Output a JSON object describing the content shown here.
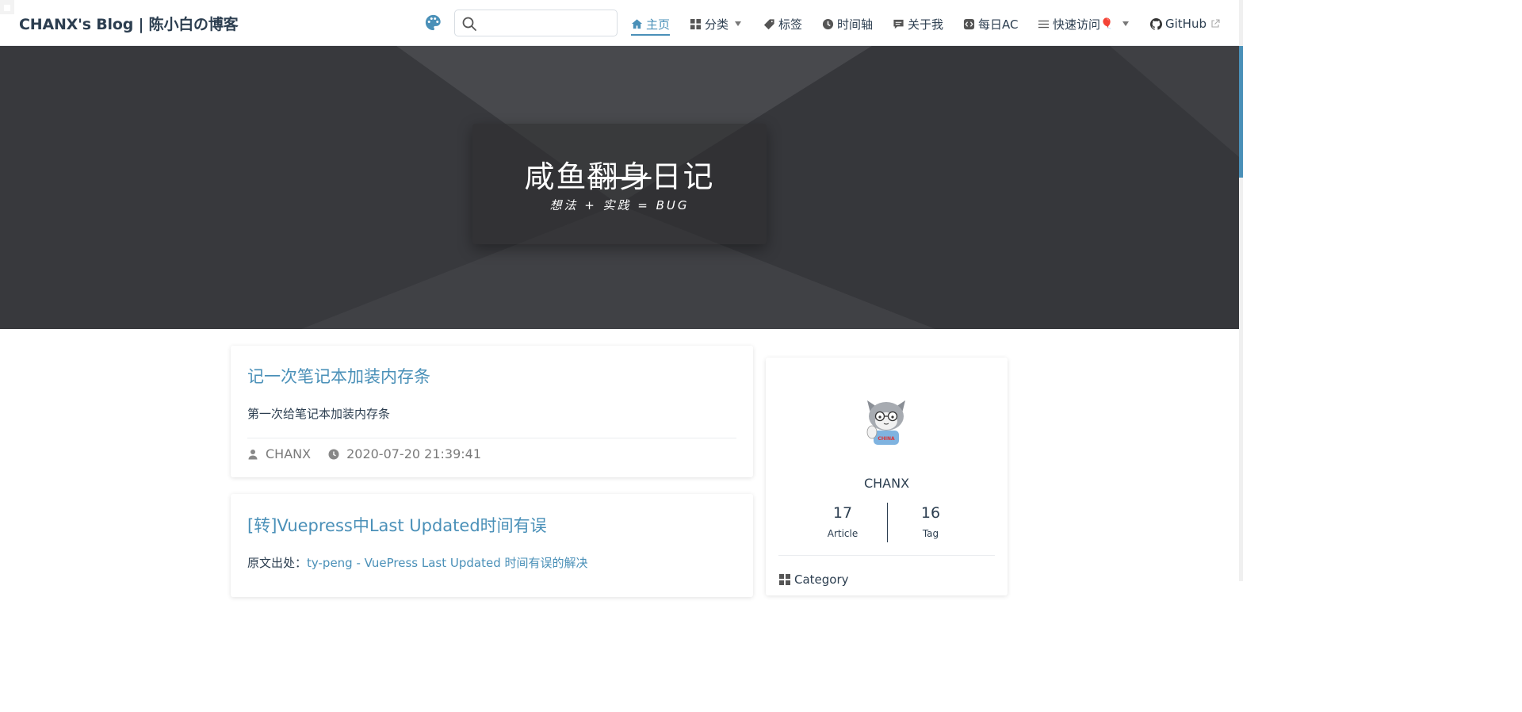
{
  "site": {
    "name": "CHANX's Blog | 陈小白の博客"
  },
  "search": {
    "placeholder": "",
    "value": ""
  },
  "nav": {
    "items": [
      {
        "label": "主页",
        "icon": "home-icon",
        "active": true
      },
      {
        "label": "分类",
        "icon": "grid-icon",
        "dropdown": true
      },
      {
        "label": "标签",
        "icon": "tag-icon"
      },
      {
        "label": "时间轴",
        "icon": "clock-icon"
      },
      {
        "label": "关于我",
        "icon": "comment-icon"
      },
      {
        "label": "每日AC",
        "icon": "code-icon"
      },
      {
        "label": "快速访问",
        "icon": "list-icon",
        "badge": "🎈",
        "dropdown": true
      },
      {
        "label": "GitHub",
        "icon": "github-icon",
        "external": true
      }
    ]
  },
  "hero": {
    "title_start": "咸鱼",
    "title_struck": "翻身",
    "title_end": "日记",
    "subtitle": "想法 + 实践 = BUG"
  },
  "posts": [
    {
      "title": "记一次笔记本加装内存条",
      "excerpt": "第一次给笔记本加装内存条",
      "author": "CHANX",
      "date": "2020-07-20 21:39:41"
    },
    {
      "title": "[转]Vuepress中Last Updated时间有误",
      "excerpt_prefix": "原文出处：",
      "excerpt_link": "ty-peng - VuePress Last Updated 时间有误的解决"
    }
  ],
  "profile": {
    "name": "CHANX",
    "avatar_text": "CHINA",
    "article_count": "17",
    "article_label": "Article",
    "tag_count": "16",
    "tag_label": "Tag",
    "category_heading": "Category"
  },
  "colors": {
    "accent": "#4a90b8",
    "text": "#2c3e50",
    "hero_bg": "#3b3b3f"
  }
}
